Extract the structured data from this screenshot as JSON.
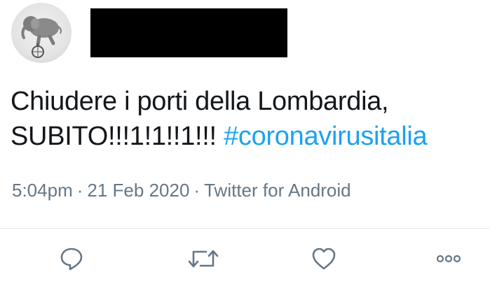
{
  "tweet": {
    "text_line1": "Chiudere i porti della Lombardia,",
    "text_line2": "SUBITO!!!1!1!!1!!! ",
    "hashtag": "#coronavirusitalia",
    "time": "5:04pm",
    "separator": "·",
    "date": "21 Feb 2020",
    "source": "Twitter for Android"
  },
  "icons": {
    "avatar": "elephant-on-unicycle-icon",
    "reply": "reply-icon",
    "retweet": "retweet-icon",
    "like": "heart-icon",
    "more": "more-icon"
  },
  "colors": {
    "text": "#14171a",
    "link": "#1da1f2",
    "meta": "#657786",
    "icon": "#657786",
    "divider": "#e1e8ed"
  }
}
